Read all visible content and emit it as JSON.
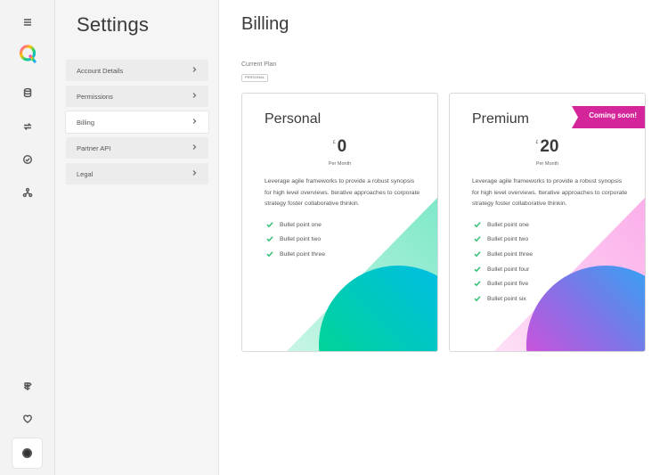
{
  "settings": {
    "title": "Settings",
    "menu": [
      {
        "label": "Account Details"
      },
      {
        "label": "Permissions"
      },
      {
        "label": "Billing"
      },
      {
        "label": "Partner API"
      },
      {
        "label": "Legal"
      }
    ],
    "active_index": 2
  },
  "rail": {
    "icons": [
      "menu-icon",
      "logo",
      "database-icon",
      "transfer-icon",
      "check-circle-icon",
      "network-icon",
      "signpost-icon",
      "heart-icon",
      "avatar"
    ]
  },
  "billing": {
    "title": "Billing",
    "current_plan_label": "Current Plan",
    "current_plan_badge": "PERSONAL",
    "plans": [
      {
        "name": "Personal",
        "currency": "£",
        "price": "0",
        "period": "Per Month",
        "description": "Leverage agile frameworks to provide a robust synopsis for high level overviews. Iterative approaches to corporate strategy foster collaborative thinkin.",
        "bullets": [
          "Bullet point one",
          "Bullet point two",
          "Bullet point three"
        ]
      },
      {
        "name": "Premium",
        "currency": "£",
        "price": "20",
        "period": "Per Month",
        "description": "Leverage agile frameworks to provide a robust synopsis for high level overviews. Iterative approaches to corporate strategy foster collaborative thinkin.",
        "bullets": [
          "Bullet point one",
          "Bullet point two",
          "Bullet point three",
          "Bullet point four",
          "Bullet point five",
          "Bullet point six"
        ],
        "ribbon": "Coming soon!"
      }
    ]
  },
  "colors": {
    "accent_green": "#2fbf71",
    "ribbon_magenta": "#d4259a",
    "personal_gradient": [
      "#00d98a",
      "#00c3e8"
    ],
    "premium_gradient": [
      "#ff3ed0",
      "#1fb0f5"
    ]
  }
}
